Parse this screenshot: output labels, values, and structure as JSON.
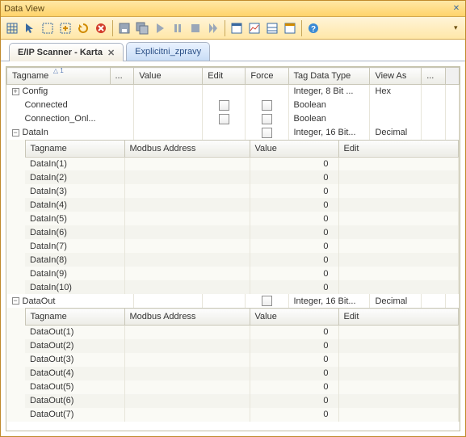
{
  "window": {
    "title": "Data View"
  },
  "tabs": {
    "active": {
      "label": "E/IP Scanner - Karta"
    },
    "inactive": {
      "label": "Explicitni_zpravy"
    }
  },
  "mainCols": {
    "tagname": "Tagname",
    "dots": "...",
    "value": "Value",
    "edit": "Edit",
    "force": "Force",
    "datatype": "Tag Data Type",
    "viewas": "View As",
    "dots2": "...",
    "sortNum": "1"
  },
  "subCols": {
    "tagname": "Tagname",
    "modbus": "Modbus Address",
    "value": "Value",
    "edit": "Edit"
  },
  "rows": {
    "config": {
      "name": "Config",
      "datatype": "Integer, 8 Bit ...",
      "viewas": "Hex"
    },
    "connected": {
      "name": "Connected",
      "datatype": "Boolean"
    },
    "conn_onl": {
      "name": "Connection_Onl...",
      "datatype": "Boolean"
    },
    "datain": {
      "name": "DataIn",
      "datatype": "Integer, 16 Bit...",
      "viewas": "Decimal"
    },
    "dataout": {
      "name": "DataOut",
      "datatype": "Integer, 16 Bit...",
      "viewas": "Decimal"
    }
  },
  "dataIn": [
    {
      "name": "DataIn(1)",
      "value": "0"
    },
    {
      "name": "DataIn(2)",
      "value": "0"
    },
    {
      "name": "DataIn(3)",
      "value": "0"
    },
    {
      "name": "DataIn(4)",
      "value": "0"
    },
    {
      "name": "DataIn(5)",
      "value": "0"
    },
    {
      "name": "DataIn(6)",
      "value": "0"
    },
    {
      "name": "DataIn(7)",
      "value": "0"
    },
    {
      "name": "DataIn(8)",
      "value": "0"
    },
    {
      "name": "DataIn(9)",
      "value": "0"
    },
    {
      "name": "DataIn(10)",
      "value": "0"
    }
  ],
  "dataOut": [
    {
      "name": "DataOut(1)",
      "value": "0"
    },
    {
      "name": "DataOut(2)",
      "value": "0"
    },
    {
      "name": "DataOut(3)",
      "value": "0"
    },
    {
      "name": "DataOut(4)",
      "value": "0"
    },
    {
      "name": "DataOut(5)",
      "value": "0"
    },
    {
      "name": "DataOut(6)",
      "value": "0"
    },
    {
      "name": "DataOut(7)",
      "value": "0"
    }
  ]
}
